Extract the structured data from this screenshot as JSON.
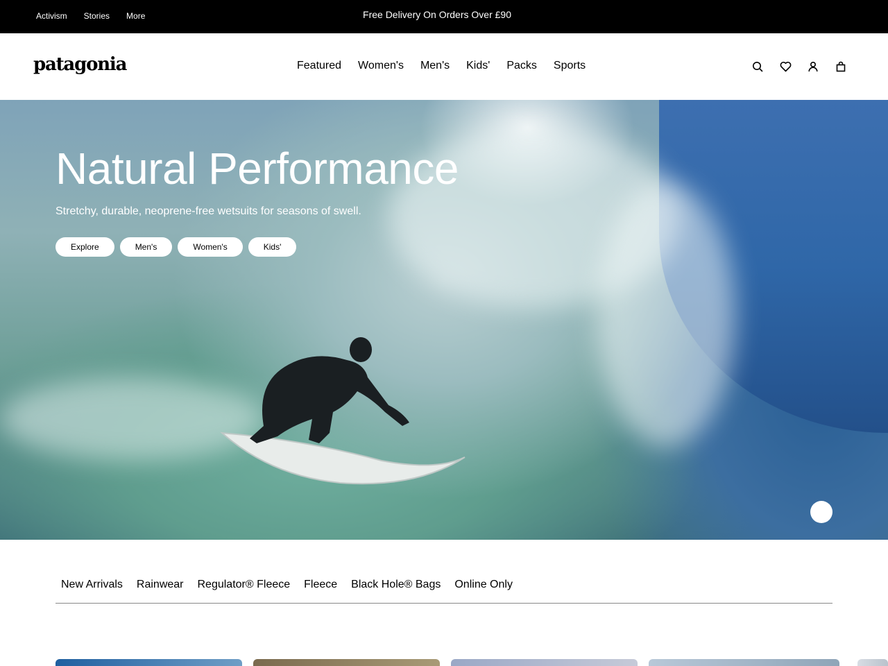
{
  "topbar": {
    "utility_links": [
      "Activism",
      "Stories",
      "More"
    ],
    "promo": "Free Delivery On Orders Over £90"
  },
  "header": {
    "logo_text": "patagonia",
    "nav": [
      "Featured",
      "Women's",
      "Men's",
      "Kids'",
      "Packs",
      "Sports"
    ],
    "icons": [
      "search-icon",
      "heart-icon",
      "account-icon",
      "bag-icon"
    ]
  },
  "hero": {
    "title": "Natural Performance",
    "subtitle": "Stretchy, durable, neoprene-free wetsuits for seasons of swell.",
    "buttons": [
      "Explore",
      "Men's",
      "Women's",
      "Kids'"
    ]
  },
  "categories": [
    "New Arrivals",
    "Rainwear",
    "Regulator® Fleece",
    "Fleece",
    "Black Hole® Bags",
    "Online Only"
  ],
  "colors": {
    "topbar_bg": "#000000",
    "accent": "#ffffff",
    "divider": "#888888"
  }
}
